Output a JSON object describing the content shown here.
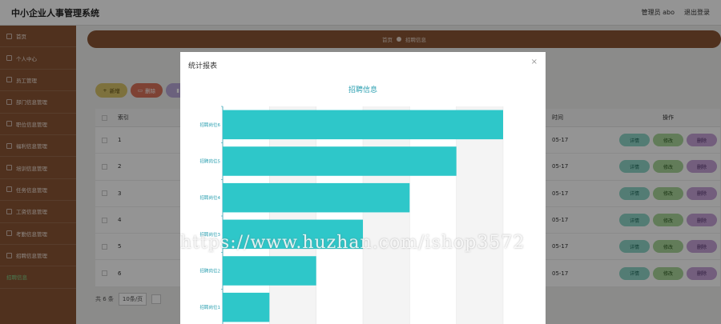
{
  "app": {
    "title": "中小企业人事管理系统",
    "user": "管理员 abo",
    "logout": "退出登录"
  },
  "sidebar": {
    "items": [
      {
        "label": "首页",
        "active": false
      },
      {
        "label": "个人中心",
        "active": false
      },
      {
        "label": "员工管理",
        "active": false
      },
      {
        "label": "部门信息管理",
        "active": false
      },
      {
        "label": "职位信息管理",
        "active": false
      },
      {
        "label": "福利信息管理",
        "active": false
      },
      {
        "label": "培训信息管理",
        "active": false
      },
      {
        "label": "任务信息管理",
        "active": false
      },
      {
        "label": "工资信息管理",
        "active": false
      },
      {
        "label": "考勤信息管理",
        "active": false
      },
      {
        "label": "招聘信息管理",
        "active": false
      },
      {
        "label": "招聘信息",
        "active": true
      }
    ]
  },
  "breadcrumb": {
    "home": "首页",
    "current": "招聘信息"
  },
  "toolbar": {
    "add": "新增",
    "delete": "删除"
  },
  "table": {
    "headers": {
      "index": "索引",
      "date": "时间",
      "ops": "操作"
    },
    "ops": {
      "detail": "详情",
      "edit": "修改",
      "delete": "删除"
    },
    "rows": [
      {
        "index": "1",
        "date": "05-17"
      },
      {
        "index": "2",
        "date": "05-17"
      },
      {
        "index": "3",
        "date": "05-17"
      },
      {
        "index": "4",
        "date": "05-17"
      },
      {
        "index": "5",
        "date": "05-17"
      },
      {
        "index": "6",
        "date": "05-17"
      }
    ]
  },
  "pager": {
    "total": "共 6 条",
    "page_size": "10条/页"
  },
  "modal": {
    "title": "统计报表",
    "close": "×"
  },
  "watermark": "https://www.huzhan.com/ishop3572",
  "chart_data": {
    "type": "bar",
    "orientation": "horizontal",
    "title": "招聘信息",
    "categories": [
      "招聘岗位1",
      "招聘岗位2",
      "招聘岗位3",
      "招聘岗位4",
      "招聘岗位5",
      "招聘岗位6"
    ],
    "values": [
      1,
      2,
      3,
      4,
      5,
      6
    ],
    "xlim": [
      0,
      6
    ],
    "x_ticks": [
      0,
      1,
      2,
      3,
      4,
      5,
      6
    ],
    "color": "#2ec7c9",
    "grid": true
  }
}
